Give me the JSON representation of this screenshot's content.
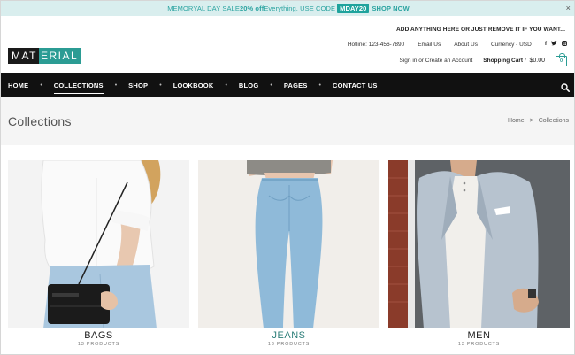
{
  "promo": {
    "text_prefix": "MEMORYAL DAY SALE ",
    "highlight": "20% off",
    "text_mid": " Everything. USE CODE ",
    "code": "MDAY20",
    "link": "SHOP NOW",
    "close": "×"
  },
  "header": {
    "tagline": "ADD ANYTHING HERE OR JUST REMOVE IT IF YOU WANT...",
    "logo_part1": "MAT",
    "logo_part2": "ERIAL",
    "hotline": "Hotline: 123-456-7890",
    "email": "Email Us",
    "about": "About Us",
    "currency": "Currency - USD",
    "social": [
      "f",
      "t",
      "ig"
    ],
    "account": "Sign in or Create an Account",
    "cart_label": "Shopping Cart /",
    "cart_amount": "$0.00",
    "cart_count": "0"
  },
  "nav": {
    "items": [
      "HOME",
      "COLLECTIONS",
      "SHOP",
      "LOOKBOOK",
      "BLOG",
      "PAGES",
      "CONTACT US"
    ],
    "dot": "•"
  },
  "page": {
    "title": "Collections",
    "breadcrumb": [
      "Home",
      ">",
      "Collections"
    ]
  },
  "collections": [
    {
      "name": "BAGS",
      "count": "13 PRODUCTS"
    },
    {
      "name": "JEANS",
      "count": "13 PRODUCTS"
    },
    {
      "name": "MEN",
      "count": "13 PRODUCTS"
    }
  ],
  "colors": {
    "accent": "#2b9c94",
    "promo_bg": "#d9eeee",
    "nav_bg": "#111111"
  }
}
